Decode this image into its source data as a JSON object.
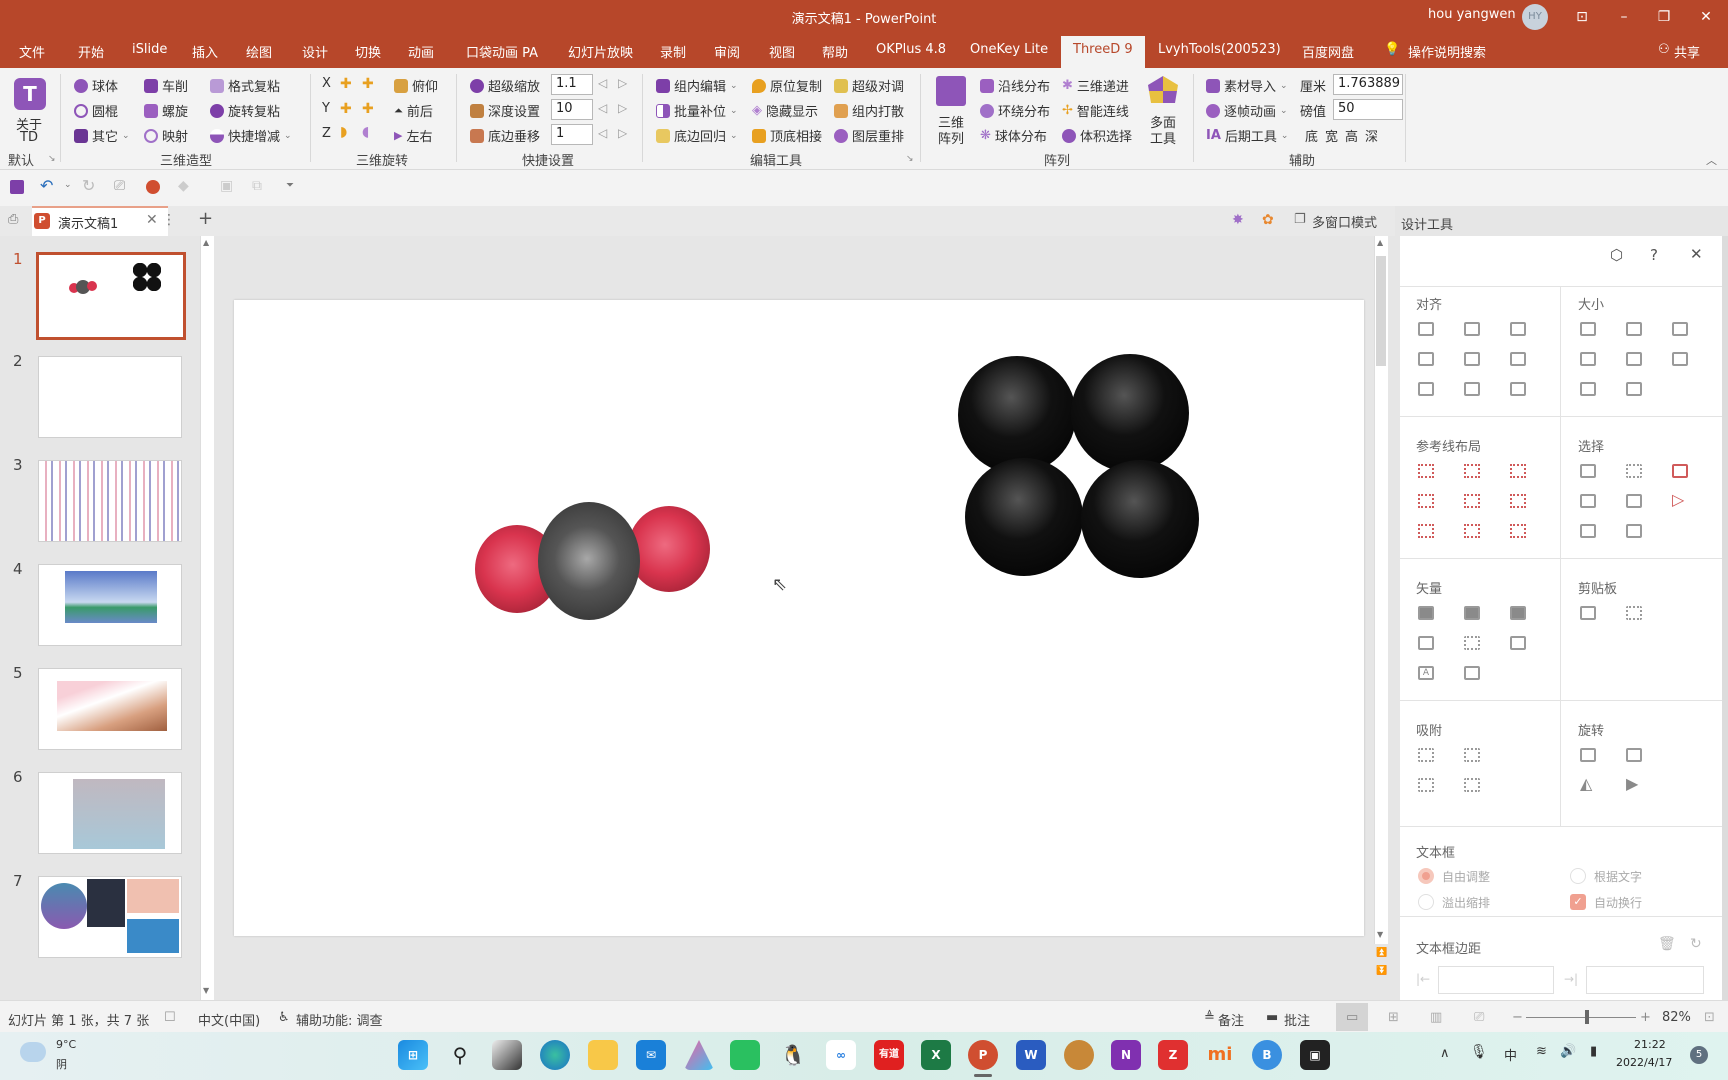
{
  "window": {
    "title": "演示文稿1 - PowerPoint",
    "user": "hou yangwen",
    "avatar": "HY",
    "buttons": [
      "ribbon-display",
      "minimize",
      "restore",
      "close"
    ]
  },
  "menu": {
    "items": [
      "文件",
      "开始",
      "iSlide",
      "插入",
      "绘图",
      "设计",
      "切换",
      "动画",
      "口袋动画 PA",
      "幻灯片放映",
      "录制",
      "审阅",
      "视图",
      "帮助",
      "OKPlus 4.8",
      "OneKey Lite",
      "ThreeD 9",
      "LvyhTools(200523)",
      "百度网盘"
    ],
    "active": "ThreeD 9",
    "search": "操作说明搜索",
    "share": "共享"
  },
  "ribbon": {
    "default_group": {
      "about_line1": "关于",
      "about_line2": "TD",
      "label": "默认"
    },
    "shape_group": {
      "label": "三维造型",
      "items": [
        "球体",
        "车削",
        "格式复粘",
        "圆棍",
        "螺旋",
        "旋转复粘",
        "其它",
        "映射",
        "快捷增减"
      ]
    },
    "rotate_group": {
      "label": "三维旋转",
      "axes": [
        "X",
        "Y",
        "Z"
      ],
      "items": [
        "俯仰",
        "前后",
        "左右"
      ]
    },
    "quick_group": {
      "label": "快捷设置",
      "items": [
        {
          "label": "超级缩放",
          "value": "1.1"
        },
        {
          "label": "深度设置",
          "value": "10"
        },
        {
          "label": "底边垂移",
          "value": "1"
        }
      ]
    },
    "edit_group": {
      "label": "编辑工具",
      "items": [
        "组内编辑",
        "原位复制",
        "超级对调",
        "批量补位",
        "隐藏显示",
        "组内打散",
        "底边回归",
        "顶底相接",
        "图层重排"
      ]
    },
    "array_group": {
      "label": "阵列",
      "big1_line1": "三维",
      "big1_line2": "阵列",
      "items": [
        "沿线分布",
        "三维递进",
        "环绕分布",
        "智能连线",
        "球体分布",
        "体积选择"
      ],
      "big2_line1": "多面",
      "big2_line2": "工具"
    },
    "aux_group": {
      "label": "辅助",
      "items": [
        "素材导入",
        "逐帧动画",
        "后期工具"
      ],
      "cm_label": "厘米",
      "cm_value": "1.763889",
      "pt_label": "磅值",
      "pt_value": "50",
      "dims": [
        "底",
        "宽",
        "高",
        "深"
      ]
    }
  },
  "tabs": {
    "doc": "演示文稿1",
    "multiwindow": "多窗口模式"
  },
  "slides": {
    "count": 7,
    "current": 1,
    "numbers": [
      "1",
      "2",
      "3",
      "4",
      "5",
      "6",
      "7"
    ]
  },
  "design_pane": {
    "title": "设计工具",
    "sections": {
      "align": "对齐",
      "size": "大小",
      "guide": "参考线布局",
      "select": "选择",
      "vector": "矢量",
      "clipboard": "剪贴板",
      "snap": "吸附",
      "rotate": "旋转",
      "textbox": "文本框",
      "margin": "文本框边距"
    },
    "textbox": {
      "opt1": "自由调整",
      "opt2": "根据文字",
      "opt3": "溢出缩排",
      "opt4": "自动换行",
      "opt1_selected": true,
      "opt4_checked": true
    }
  },
  "status": {
    "slide_info": "幻灯片 第 1 张，共 7 张",
    "language": "中文(中国)",
    "accessibility": "辅助功能: 调查",
    "notes": "备注",
    "comments": "批注",
    "zoom": "82%",
    "zoom_fraction": 0.55
  },
  "taskbar": {
    "weather_temp": "9°C",
    "weather_desc": "阴",
    "time": "21:22",
    "date": "2022/4/17",
    "notif": "5",
    "ime": "中"
  },
  "colors": {
    "accent": "#b7472a",
    "oxygen": "#d9344e",
    "carbon": "#4a4a4a",
    "black_sphere": "#111111"
  }
}
